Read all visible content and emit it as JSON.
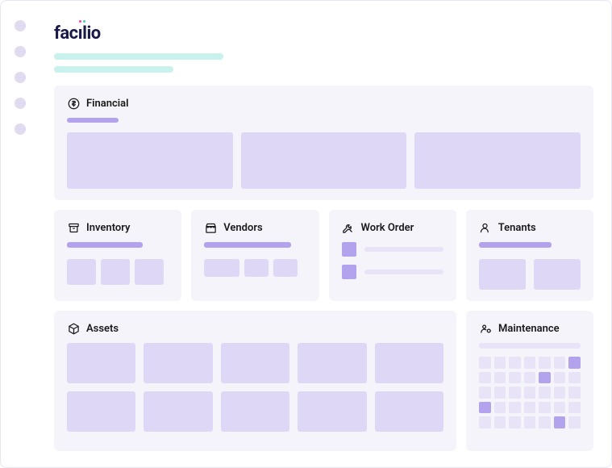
{
  "logo": {
    "text_before_i": "fac",
    "text_after_i": "lio",
    "letter_i": "i"
  },
  "cards": {
    "financial": {
      "title": "Financial"
    },
    "inventory": {
      "title": "Inventory"
    },
    "vendors": {
      "title": "Vendors"
    },
    "work_order": {
      "title": "Work Order"
    },
    "tenants": {
      "title": "Tenants"
    },
    "assets": {
      "title": "Assets"
    },
    "maintenance": {
      "title": "Maintenance"
    }
  },
  "icons": {
    "financial": "dollar-circle-icon",
    "inventory": "archive-icon",
    "vendors": "storefront-icon",
    "work_order": "tools-icon",
    "tenants": "person-icon",
    "assets": "cube-icon",
    "maintenance": "maintenance-icon"
  },
  "maintenance_calendar": {
    "cells": [
      0,
      0,
      0,
      0,
      0,
      0,
      1,
      0,
      0,
      0,
      0,
      1,
      0,
      0,
      0,
      0,
      0,
      0,
      0,
      0,
      0,
      1,
      0,
      0,
      0,
      0,
      0,
      0,
      0,
      0,
      0,
      0,
      0,
      1,
      0
    ]
  },
  "colors": {
    "accent_purple": "#b3a3ec",
    "block_purple": "#ded7f5",
    "block_light": "#e8e3f7",
    "card_bg": "#f6f4fb",
    "teal": "#c8f2eb"
  }
}
